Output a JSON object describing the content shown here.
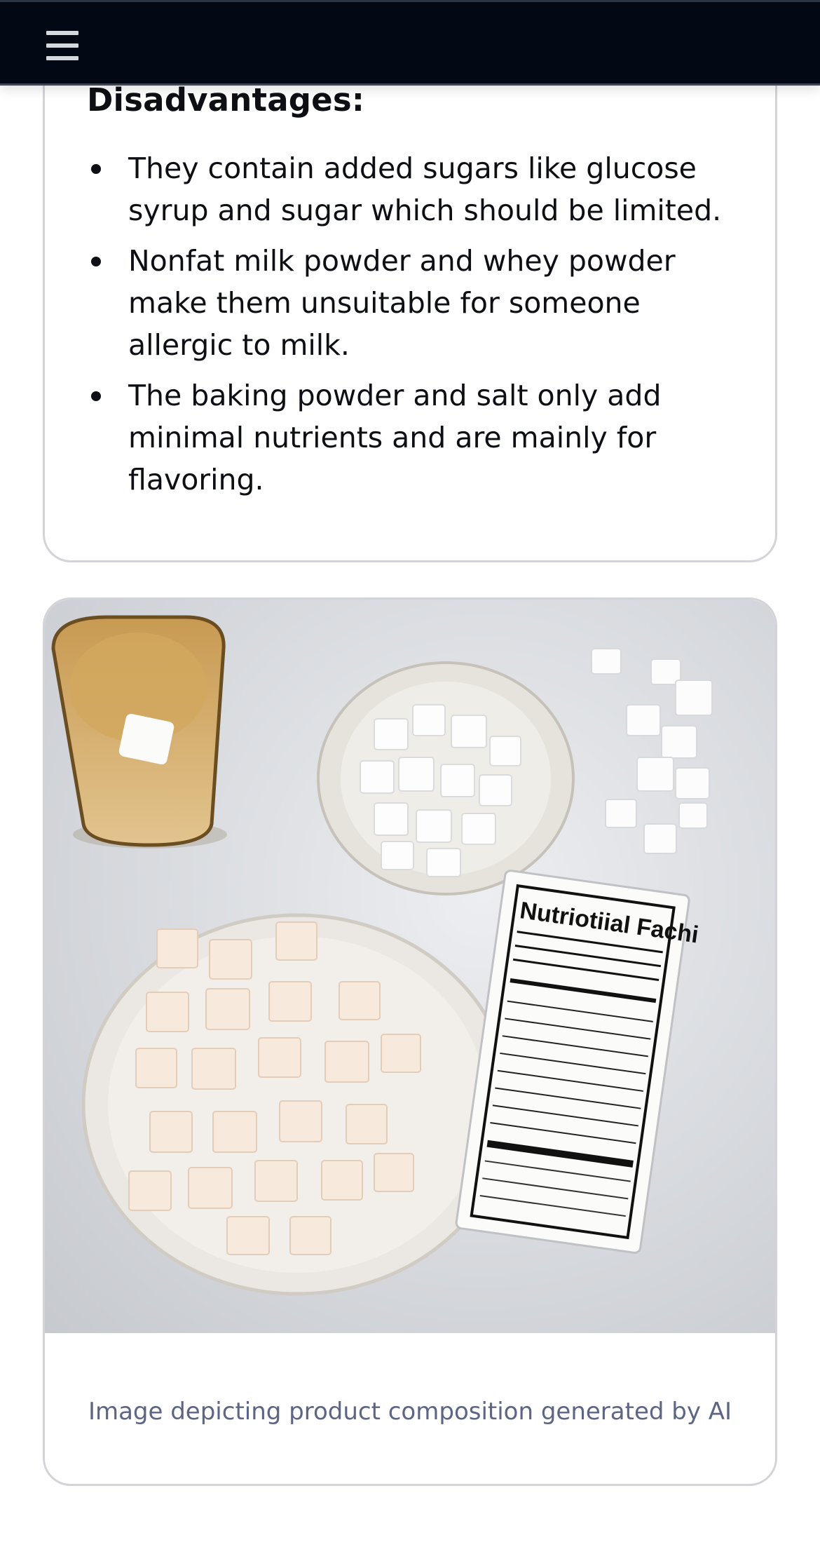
{
  "header": {
    "menu_icon": "hamburger-menu-icon"
  },
  "section": {
    "heading": "Disadvantages:",
    "items": [
      "They contain added sugars like glucose syrup and sugar which should be limited.",
      "Nonfat milk powder and whey powder make them unsuitable for someone allergic to milk.",
      "The baking powder and salt only add minimal nutrients and are mainly for flavoring."
    ]
  },
  "figure": {
    "label_title": "Nutriotiial Fachi",
    "caption": "Image depicting product composition generated by AI"
  },
  "colors": {
    "topbar": "#020814",
    "caption": "#5c6585",
    "border": "#d2d4da"
  }
}
